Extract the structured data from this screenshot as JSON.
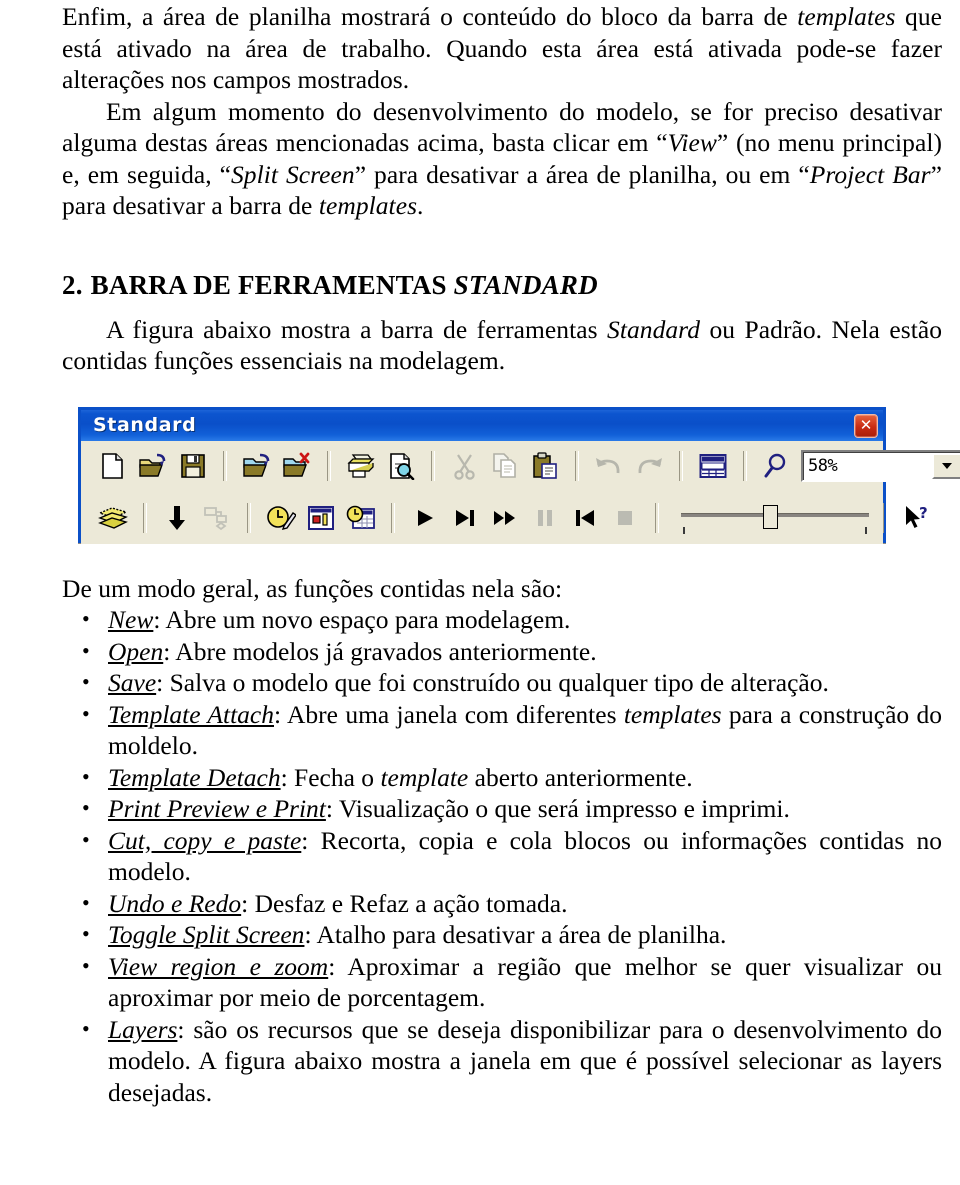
{
  "document": {
    "paragraph_1": {
      "line_a": "Enfim, a área de planilha mostrará o conteúdo do bloco da barra de ",
      "italic_1": "templates",
      "line_b": " que está ativado na área de trabalho. Quando esta área está ativada pode-se fazer alterações nos campos mostrados."
    },
    "paragraph_2": {
      "seg_a": "Em algum momento do desenvolvimento do modelo, se for preciso desativar alguma destas áreas mencionadas acima, basta clicar em “",
      "italic_view": "View",
      "seg_b": "” (no menu principal) e, em seguida, “",
      "italic_split": "Split Screen",
      "seg_c": "” para desativar a área de planilha, ou em “",
      "italic_project": "Project Bar",
      "seg_d": "” para desativar a barra de ",
      "italic_templates": "templates",
      "seg_e": "."
    },
    "heading": {
      "number": "2.",
      "text": "BARRA DE FERRAMENTAS ",
      "italic": "STANDARD"
    },
    "paragraph_3": {
      "seg_a": "A figura abaixo mostra a barra de ferramentas ",
      "italic_standard": "Standard",
      "seg_b": " ou Padrão. Nela estão contidas funções essenciais na modelagem."
    },
    "paragraph_4": "De um modo geral, as funções contidas nela são:",
    "bullets": [
      {
        "term": "New",
        "sep": ": ",
        "desc": "Abre um novo espaço para modelagem."
      },
      {
        "term": "Open",
        "sep": ": ",
        "desc": "Abre modelos já gravados anteriormente."
      },
      {
        "term": "Save",
        "sep": ": ",
        "desc": "Salva o modelo que foi construído ou qualquer tipo de alteração."
      },
      {
        "term": "Template Attach",
        "sep": ": ",
        "desc_a": "Abre uma janela com diferentes ",
        "desc_italic": "templates",
        "desc_b": " para a construção do moldelo."
      },
      {
        "term": "Template Detach",
        "sep": ": ",
        "desc_a": "Fecha o ",
        "desc_italic": "template",
        "desc_b": " aberto anteriormente."
      },
      {
        "term": "Print Preview e Print",
        "sep": ": ",
        "desc": "Visualização o que será impresso e imprimi."
      },
      {
        "term": "Cut, copy e paste",
        "sep": ": ",
        "desc": "Recorta, copia e cola blocos ou informações contidas no modelo."
      },
      {
        "term": "Undo e Redo",
        "sep": ": ",
        "desc": "Desfaz e Refaz a ação tomada."
      },
      {
        "term": "Toggle Split Screen",
        "sep": ": ",
        "desc": "Atalho para desativar a área de planilha."
      },
      {
        "term": "View region e zoom",
        "sep": ": ",
        "desc": "Aproximar a região que melhor se quer visualizar ou aproximar por meio de porcentagem."
      },
      {
        "term": "Layers",
        "sep": ": ",
        "desc": "são os recursos que se deseja disponibilizar para o desenvolvimento do modelo. A figura abaixo mostra a janela em que é possível selecionar as layers desejadas."
      }
    ]
  },
  "figure_toolbar": {
    "title": "Standard",
    "close_glyph": "✕",
    "zoom_value": "58%",
    "dropdown_glyph": "▼",
    "row1_icons": [
      "new-document-icon",
      "open-folder-icon",
      "save-disk-icon",
      "template-attach-icon",
      "template-detach-icon",
      "print-icon",
      "print-preview-icon",
      "cut-scissors-icon",
      "copy-icon",
      "paste-clipboard-icon",
      "undo-icon",
      "redo-icon",
      "toggle-split-screen-icon",
      "zoom-magnifier-icon"
    ],
    "row2_icons": [
      "layers-icon",
      "down-arrow-icon",
      "hierarchy-icon",
      "clock-edit-icon",
      "chart-icon",
      "calendar-clock-icon",
      "play-icon",
      "step-forward-icon",
      "fast-forward-icon",
      "pause-icon",
      "rewind-icon",
      "stop-icon",
      "speed-slider",
      "help-pointer-icon"
    ],
    "colors": {
      "titlebar_blue": "#0c55cf",
      "frame_blue": "#0b50c8",
      "toolbar_face": "#ece9d8",
      "close_red": "#c82b12",
      "icon_gold": "#c8b400",
      "icon_navy": "#202080"
    }
  }
}
